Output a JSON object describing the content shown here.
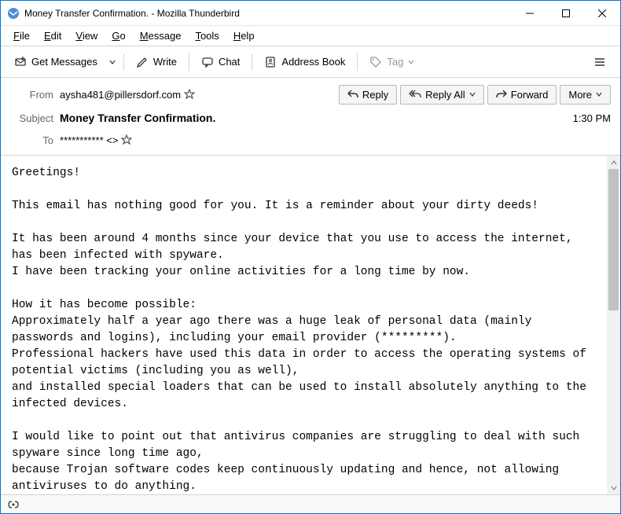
{
  "window": {
    "title": "Money Transfer Confirmation. - Mozilla Thunderbird"
  },
  "menubar": {
    "items": [
      {
        "label": "File",
        "accel": "F"
      },
      {
        "label": "Edit",
        "accel": "E"
      },
      {
        "label": "View",
        "accel": "V"
      },
      {
        "label": "Go",
        "accel": "G"
      },
      {
        "label": "Message",
        "accel": "M"
      },
      {
        "label": "Tools",
        "accel": "T"
      },
      {
        "label": "Help",
        "accel": "H"
      }
    ]
  },
  "toolbar": {
    "get_messages": "Get Messages",
    "write": "Write",
    "chat": "Chat",
    "address_book": "Address Book",
    "tag": "Tag"
  },
  "header": {
    "from_label": "From",
    "from_value": "aysha481@pillersdorf.com",
    "subject_label": "Subject",
    "subject_value": "Money Transfer Confirmation.",
    "to_label": "To",
    "to_value": "*********** <>",
    "time": "1:30 PM"
  },
  "actions": {
    "reply": "Reply",
    "reply_all": "Reply All",
    "forward": "Forward",
    "more": "More"
  },
  "body": "Greetings!\n\nThis email has nothing good for you. It is a reminder about your dirty deeds!\n\nIt has been around 4 months since your device that you use to access the internet, has been infected with spyware.\nI have been tracking your online activities for a long time by now.\n\nHow it has become possible:\nApproximately half a year ago there was a huge leak of personal data (mainly passwords and logins), including your email provider (*********).\nProfessional hackers have used this data in order to access the operating systems of potential victims (including you as well),\nand installed special loaders that can be used to install absolutely anything to the infected devices.\n\nI would like to point out that antivirus companies are struggling to deal with such spyware since long time ago,\nbecause Trojan software codes keep continuously updating and hence, not allowing antiviruses to do anything."
}
